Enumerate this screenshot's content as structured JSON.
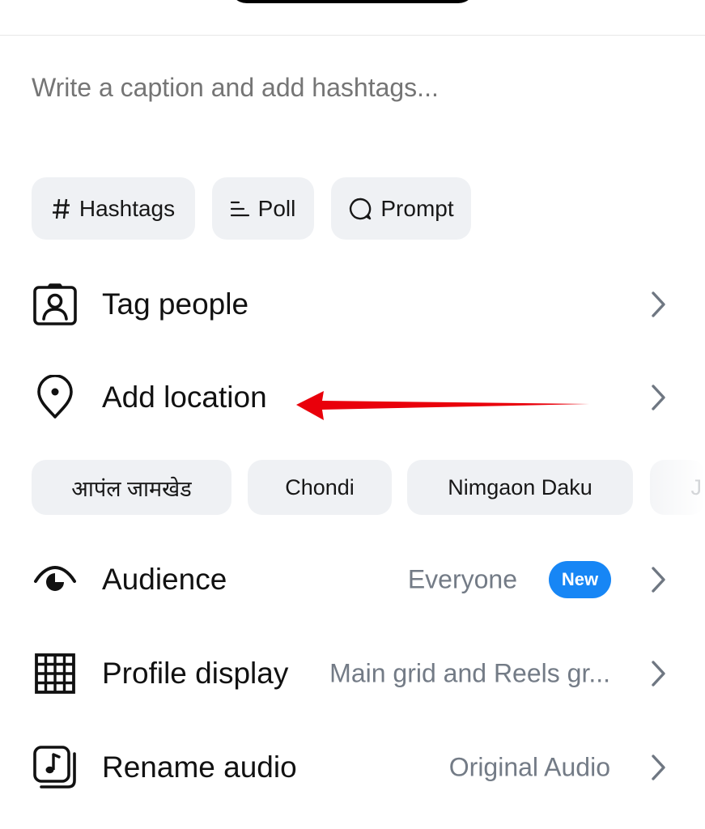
{
  "caption": {
    "placeholder": "Write a caption and add hashtags..."
  },
  "chips": [
    {
      "label": "Hashtags",
      "icon": "hashtag-icon"
    },
    {
      "label": "Poll",
      "icon": "poll-icon"
    },
    {
      "label": "Prompt",
      "icon": "prompt-icon"
    }
  ],
  "rows": {
    "tag_people": {
      "label": "Tag people",
      "icon": "tag-people-icon"
    },
    "add_location": {
      "label": "Add location",
      "icon": "location-pin-icon"
    },
    "audience": {
      "label": "Audience",
      "value": "Everyone",
      "badge": "New",
      "icon": "audience-icon"
    },
    "profile_display": {
      "label": "Profile display",
      "value": "Main grid and Reels gr...",
      "icon": "grid-icon"
    },
    "rename_audio": {
      "label": "Rename audio",
      "value": "Original Audio",
      "icon": "audio-icon"
    }
  },
  "location_suggestions": [
    "आपंल जामखेड",
    "Chondi",
    "Nimgaon Daku",
    "J"
  ],
  "colors": {
    "accent_badge": "#1786f5",
    "annotation_arrow": "#e9000b",
    "chip_background": "#eff1f4",
    "secondary_text": "#737b86"
  }
}
